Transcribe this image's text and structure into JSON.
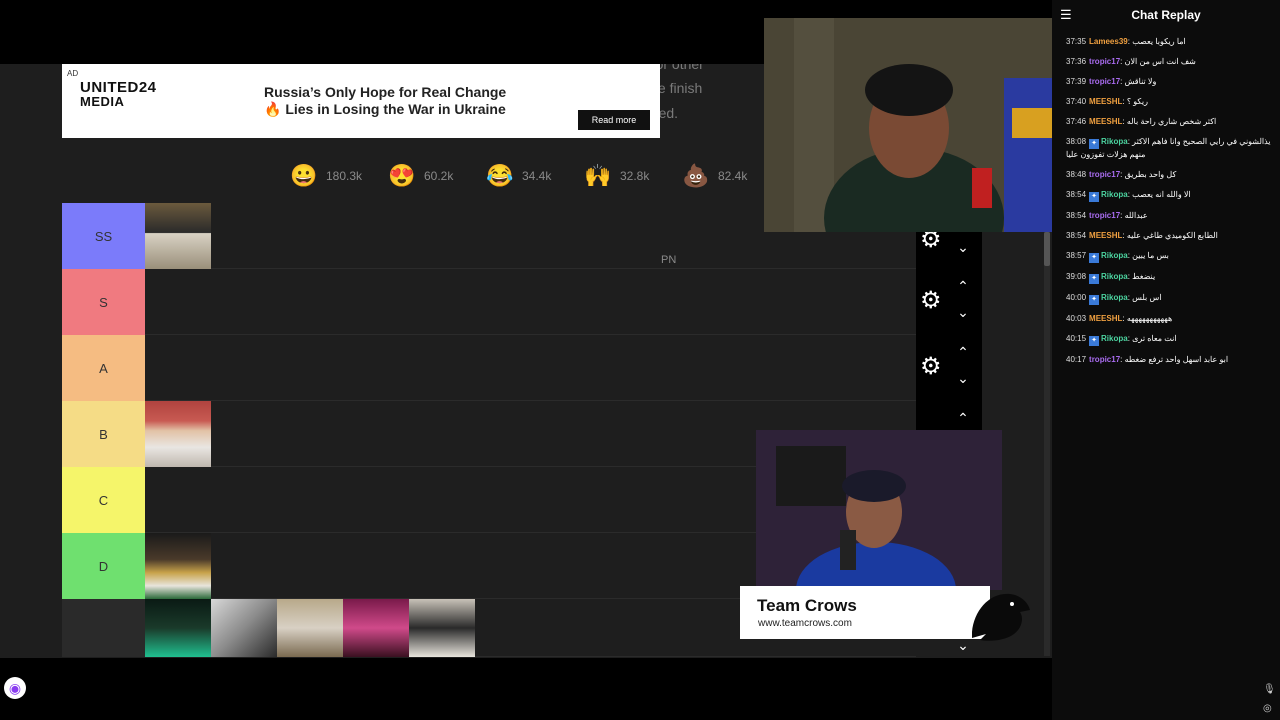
{
  "page_text": {
    "frag1": "emplate for other",
    "frag2": "wnload the finish",
    "frag3": "e removed.",
    "pn": "PN"
  },
  "ad": {
    "tag": "AD",
    "logo_line1": "UNITED24",
    "logo_line2": "MEDIA",
    "headline_line1": "Russia’s Only Hope for Real Change",
    "headline_line2": "🔥 Lies in Losing the War in Ukraine",
    "button": "Read more"
  },
  "reactions": [
    {
      "emoji": "😀",
      "icon": "grin-emoji-icon",
      "count": "180.3k"
    },
    {
      "emoji": "😍",
      "icon": "heart-eyes-emoji-icon",
      "count": "60.2k"
    },
    {
      "emoji": "😂",
      "icon": "laugh-emoji-icon",
      "count": "34.4k"
    },
    {
      "emoji": "🙌",
      "icon": "raised-hands-emoji-icon",
      "count": "32.8k"
    },
    {
      "emoji": "💩",
      "icon": "poop-emoji-icon",
      "count": "82.4k"
    }
  ],
  "tiers": [
    {
      "label": "SS",
      "color": "#7b7bfa",
      "items": 1
    },
    {
      "label": "S",
      "color": "#f07a80",
      "items": 0
    },
    {
      "label": "A",
      "color": "#f5bc82",
      "items": 0
    },
    {
      "label": "B",
      "color": "#f5dc86",
      "items": 1
    },
    {
      "label": "C",
      "color": "#f5f56a",
      "items": 0
    },
    {
      "label": "D",
      "color": "#6fe06f",
      "items": 1
    },
    {
      "label": "",
      "color": "#2a2a2a",
      "items": 5
    }
  ],
  "banner": {
    "title": "Team Crows",
    "url": "www.teamcrows.com"
  },
  "chat": {
    "title": "Chat Replay",
    "messages": [
      {
        "time": "37:35",
        "user": "Lamees39",
        "color": "#f0a040",
        "badge": false,
        "text": "اما ريكوبا يعصب"
      },
      {
        "time": "37:36",
        "user": "tropic17",
        "color": "#a96cf0",
        "badge": false,
        "text": "شف انت اس من الان"
      },
      {
        "time": "37:39",
        "user": "tropic17",
        "color": "#a96cf0",
        "badge": false,
        "text": "ولا تناقش"
      },
      {
        "time": "37:40",
        "user": "MEESHL",
        "color": "#f0a040",
        "badge": false,
        "text": "ريكو ؟"
      },
      {
        "time": "37:46",
        "user": "MEESHL",
        "color": "#f0a040",
        "badge": false,
        "text": "اكثر شخص شاري راحة باله"
      },
      {
        "time": "38:08",
        "user": "Rikopa",
        "color": "#4cd4a0",
        "badge": true,
        "text": "يذالشوني في رايي الصحيح وانا فاهم الاكثر منهم هزلات تفوزون عليا"
      },
      {
        "time": "38:48",
        "user": "tropic17",
        "color": "#a96cf0",
        "badge": false,
        "text": "كل واحد بطريق"
      },
      {
        "time": "38:54",
        "user": "Rikopa",
        "color": "#4cd4a0",
        "badge": true,
        "text": "الا والله انه يعصب"
      },
      {
        "time": "38:54",
        "user": "tropic17",
        "color": "#a96cf0",
        "badge": false,
        "text": "عبدالله"
      },
      {
        "time": "38:54",
        "user": "MEESHL",
        "color": "#f0a040",
        "badge": false,
        "text": "الطابع الكوميدي طاغي عليه"
      },
      {
        "time": "38:57",
        "user": "Rikopa",
        "color": "#4cd4a0",
        "badge": true,
        "text": "بس ما يبين"
      },
      {
        "time": "39:08",
        "user": "Rikopa",
        "color": "#4cd4a0",
        "badge": true,
        "text": "ينضغط"
      },
      {
        "time": "40:00",
        "user": "Rikopa",
        "color": "#4cd4a0",
        "badge": true,
        "text": "اس بلس"
      },
      {
        "time": "40:03",
        "user": "MEESHL",
        "color": "#f0a040",
        "badge": false,
        "text": "هههههههههههه"
      },
      {
        "time": "40:15",
        "user": "Rikopa",
        "color": "#4cd4a0",
        "badge": true,
        "text": "انت معاه ترى"
      },
      {
        "time": "40:17",
        "user": "tropic17",
        "color": "#a96cf0",
        "badge": false,
        "text": "ابو عابد اسهل واحد ترفع ضغطه"
      }
    ]
  }
}
